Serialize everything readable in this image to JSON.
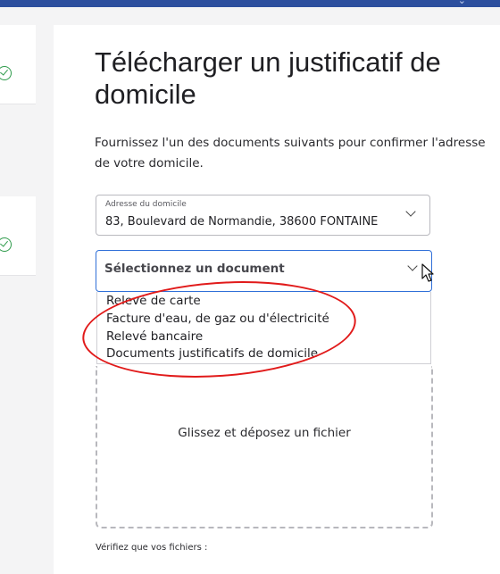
{
  "header": {
    "menu_icon": "chevron-down-icon"
  },
  "steps": [
    {
      "status_icon": "checkmark-circle-icon",
      "status": "completed"
    },
    {
      "status_icon": "checkmark-circle-icon",
      "status": "completed"
    }
  ],
  "page": {
    "title": "Télécharger un justificatif de domicile",
    "intro": "Fournissez l'un des documents suivants pour confirmer l'adresse de votre domicile."
  },
  "address_field": {
    "label": "Adresse du domicile",
    "value": "83, Boulevard de Normandie, 38600 FONTAINE"
  },
  "document_select": {
    "placeholder": "Sélectionnez un document",
    "options": [
      "Relevé de carte",
      "Facture d'eau, de gaz ou d'électricité",
      "Relevé bancaire",
      "Documents justificatifs de domicile"
    ]
  },
  "dropzone": {
    "label": "Glissez et déposez un fichier"
  },
  "verify_label": "Vérifiez que vos fichiers :",
  "colors": {
    "accent": "#2f6fd8",
    "annotation": "#e11a1a",
    "success": "#2e9b4b",
    "header": "#2c4f9e"
  }
}
